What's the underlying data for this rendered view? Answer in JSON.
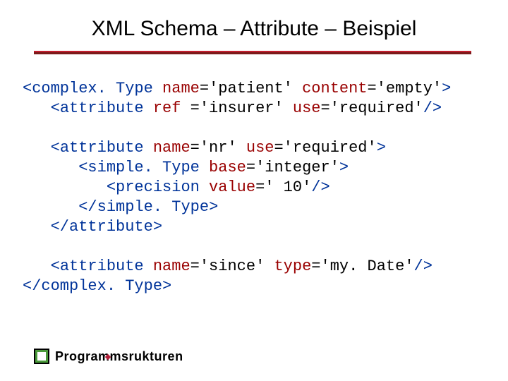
{
  "title": "XML Schema – Attribute – Beispiel",
  "logo": {
    "word1": "Pro",
    "word2": "gramms",
    "word3": "rukturen"
  },
  "code": {
    "l1_open": "<",
    "l1_tag": "complex. Type",
    "l1_sp": " ",
    "l1_a1": "name",
    "l1_eq": "=",
    "l1_v1": "'patient'",
    "l1_a2": " content",
    "l1_v2": "='empty'",
    "l1_close": ">",
    "l2_indent": "   ",
    "l2_open": "<",
    "l2_tag": "attribute",
    "l2_a1": " ref ",
    "l2_v1": "='insurer'",
    "l2_a2": " use",
    "l2_v2": "='required'",
    "l2_close": "/>",
    "l3_indent": "   ",
    "l3_open": "<",
    "l3_tag": "attribute",
    "l3_a1": " name",
    "l3_v1": "='nr'",
    "l3_a2": " use",
    "l3_v2": "='required'",
    "l3_close": ">",
    "l4_indent": "      ",
    "l4_open": "<",
    "l4_tag": "simple. Type",
    "l4_a1": " base",
    "l4_v1": "='integer'",
    "l4_close": ">",
    "l5_indent": "         ",
    "l5_open": "<",
    "l5_tag": "precision",
    "l5_a1": " value",
    "l5_v1": "=' 10'",
    "l5_close": "/>",
    "l6_indent": "      ",
    "l6_open": "</",
    "l6_tag": "simple. Type",
    "l6_close": ">",
    "l7_indent": "   ",
    "l7_open": "</",
    "l7_tag": "attribute",
    "l7_close": ">",
    "l8_indent": "   ",
    "l8_open": "<",
    "l8_tag": "attribute",
    "l8_a1": " name",
    "l8_v1": "='since'",
    "l8_a2": " type",
    "l8_v2": "='my. Date'",
    "l8_close": "/>",
    "l9_open": "</",
    "l9_tag": "complex. Type",
    "l9_close": ">"
  }
}
